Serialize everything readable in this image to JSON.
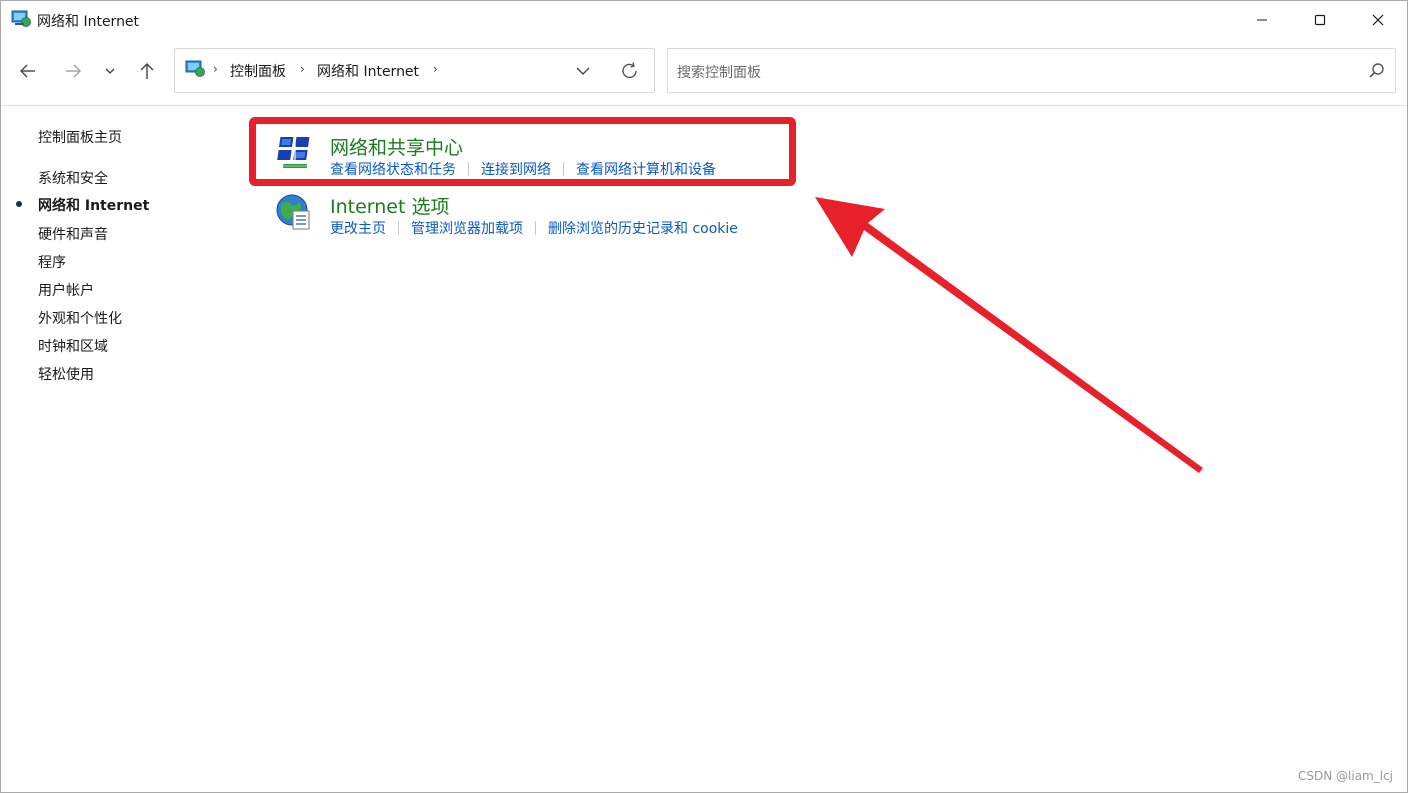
{
  "window": {
    "title": "网络和 Internet",
    "minimize_label": "Minimize",
    "maximize_label": "Maximize",
    "close_label": "Close"
  },
  "nav": {
    "back": "back-icon",
    "forward": "forward-icon",
    "recent": "chevron-down-icon",
    "up": "up-icon"
  },
  "address": {
    "crumbs": [
      "控制面板",
      "网络和 Internet"
    ],
    "separator": "›"
  },
  "search": {
    "placeholder": "搜索控制面板"
  },
  "sidebar": {
    "items": [
      {
        "label": "控制面板主页"
      },
      {
        "label": "系统和安全"
      },
      {
        "label": "网络和 Internet",
        "current": true
      },
      {
        "label": "硬件和声音"
      },
      {
        "label": "程序"
      },
      {
        "label": "用户帐户"
      },
      {
        "label": "外观和个性化"
      },
      {
        "label": "时钟和区域"
      },
      {
        "label": "轻松使用"
      }
    ]
  },
  "categories": [
    {
      "title": "网络和共享中心",
      "icon": "network-sharing-center-icon",
      "links": [
        "查看网络状态和任务",
        "连接到网络",
        "查看网络计算机和设备"
      ]
    },
    {
      "title": "Internet 选项",
      "icon": "internet-options-globe-icon",
      "links": [
        "更改主页",
        "管理浏览器加载项",
        "删除浏览的历史记录和 cookie"
      ]
    }
  ],
  "annotation": {
    "box_color": "#e8202a",
    "arrow_color": "#e8202a"
  },
  "colors": {
    "category_title": "#1e7a1e",
    "link": "#0a5ac2"
  },
  "watermark": "CSDN @liam_lcj"
}
